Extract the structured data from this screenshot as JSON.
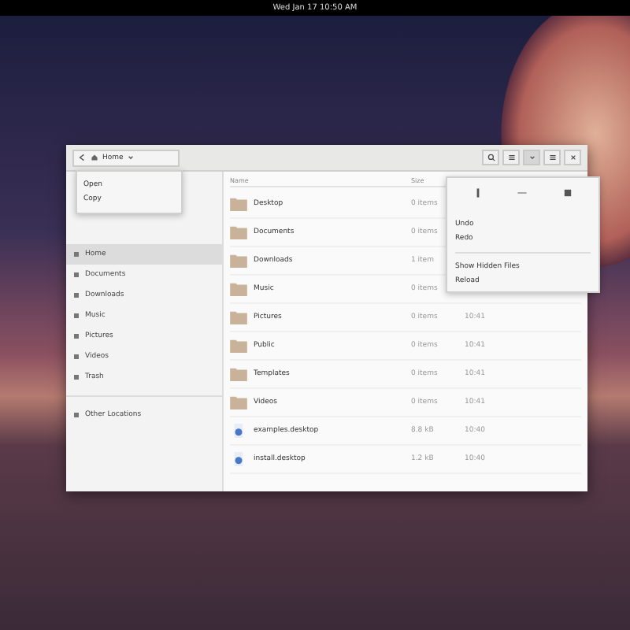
{
  "top_bar": {
    "clock": "Wed Jan 17  10:50 AM"
  },
  "window": {
    "path": "Home",
    "path_menu": [
      "Open",
      "Copy"
    ],
    "sidebar": [
      {
        "label": "Home",
        "selected": true
      },
      {
        "label": "Documents",
        "selected": false
      },
      {
        "label": "Downloads",
        "selected": false
      },
      {
        "label": "Music",
        "selected": false
      },
      {
        "label": "Pictures",
        "selected": false
      },
      {
        "label": "Videos",
        "selected": false
      },
      {
        "label": "Trash",
        "selected": false
      },
      {
        "label": "Other Locations",
        "selected": false
      }
    ],
    "columns": [
      "Name",
      "Size"
    ],
    "rows": [
      {
        "kind": "folder",
        "name": "Desktop",
        "size": "0 items"
      },
      {
        "kind": "folder",
        "name": "Documents",
        "size": "0 items"
      },
      {
        "kind": "folder",
        "name": "Downloads",
        "size": "1 item"
      },
      {
        "kind": "folder",
        "name": "Music",
        "size": "0 items"
      },
      {
        "kind": "folder",
        "name": "Pictures",
        "size": "0 items",
        "modified": "10:41"
      },
      {
        "kind": "folder",
        "name": "Public",
        "size": "0 items",
        "modified": "10:41"
      },
      {
        "kind": "folder",
        "name": "Templates",
        "size": "0 items",
        "modified": "10:41"
      },
      {
        "kind": "folder",
        "name": "Videos",
        "size": "0 items",
        "modified": "10:41"
      },
      {
        "kind": "file",
        "name": "examples.desktop",
        "size": "8.8 kB",
        "modified": "10:40"
      },
      {
        "kind": "file",
        "name": "install.desktop",
        "size": "1.2 kB",
        "modified": "10:40"
      }
    ],
    "view_menu": [
      "Undo",
      "Redo",
      "Show Hidden Files",
      "Reload"
    ]
  }
}
